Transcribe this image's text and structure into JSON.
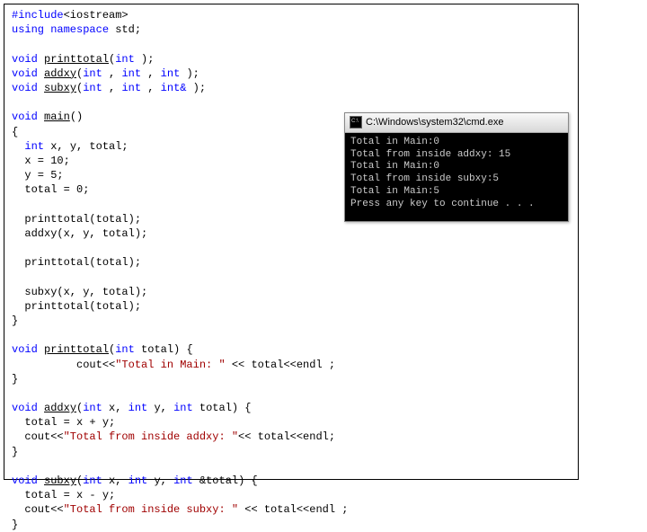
{
  "code": {
    "l1_kw": "#include",
    "l1_rest": "<iostream>",
    "l2_kw": "using namespace",
    "l2_rest": " std;",
    "l4_kw": "void ",
    "l4_fn": "printtotal",
    "l4_sig1": "(",
    "l4_kwint": "int",
    "l4_end": " );",
    "l5_fn": "addxy",
    "l5_sig": "(",
    "l5_int": "int",
    "l5_comma": " , ",
    "l5_end": " );",
    "l6_fn": "subxy",
    "l6_amp": "int&",
    "l6_end": " );",
    "l8_main": "main",
    "l8_par": "()",
    "l9_brace": "{",
    "l10": "  ",
    "l10_kw": "int",
    "l10_rest": " x, y, total;",
    "l11": "  x = 10;",
    "l12": "  y = 5;",
    "l13": "  total = 0;",
    "l15": "  printtotal(total);",
    "l16": "  addxy(x, y, total);",
    "l18": "  printtotal(total);",
    "l20": "  subxy(x, y, total);",
    "l21": "  printtotal(total);",
    "l22": "}",
    "l24_sig_end": "(",
    "l24_ktot": "int",
    "l24_ptotal": " total) {",
    "l25_pre": "          cout<<",
    "l25_str": "\"Total in Main: \"",
    "l25_post": " << total<<endl ;",
    "l26": "}",
    "l28_sig": "(",
    "l28_params": " x, ",
    "l28_y": " y, ",
    "l28_tot": " total) {",
    "l29": "  total = x + y;",
    "l30_pre": "  cout<<",
    "l30_str": "\"Total from inside addxy: \"",
    "l30_post": "<< total<<endl;",
    "l31": "}",
    "l33_amp": " &total) {",
    "l34": "  total = x - y;",
    "l35_pre": "  cout<<",
    "l35_str": "\"Total from inside subxy: \"",
    "l35_post": " << total<<endl ;",
    "l36": "}"
  },
  "console": {
    "title": "C:\\Windows\\system32\\cmd.exe",
    "out1": "Total in Main:0",
    "out2": "Total from inside addxy: 15",
    "out3": "Total in Main:0",
    "out4": "Total from inside subxy:5",
    "out5": "Total in Main:5",
    "out6": "Press any key to continue . . ."
  }
}
